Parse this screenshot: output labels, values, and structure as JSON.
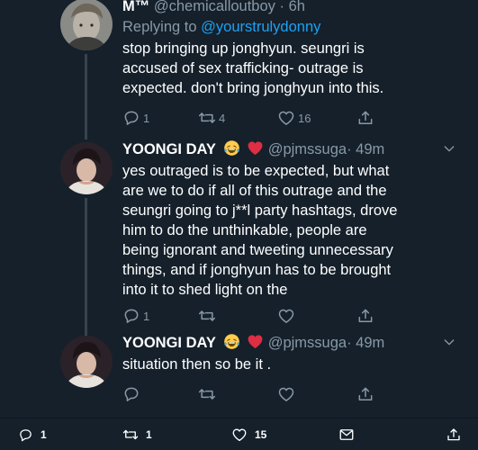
{
  "tweets": [
    {
      "display_name": "M™",
      "handle": "@chemicalloutboy",
      "time": "· 6h",
      "replying_prefix": "Replying to ",
      "replying_to": "@yourstrulydonny",
      "body_lines": [
        "stop bringing up jonghyun. seungri is",
        "accused of sex trafficking- outrage is",
        "expected. don't bring jonghyun into this."
      ],
      "reply_count": "1",
      "retweet_count": "4",
      "like_count": "16"
    },
    {
      "display_name": "YOONGI DAY",
      "name_emojis": [
        "laughing-crying-emoji",
        "red-heart-emoji"
      ],
      "handle": "@pjmssuga",
      "time": "· 49m",
      "body_lines": [
        "yes outraged is to be expected, but what",
        "are we to do if all of this outrage and the",
        "seungri going to j**l party hashtags, drove",
        "him to do the unthinkable, people are",
        "being ignorant and tweeting unnecessary",
        "things, and if jonghyun has to be brought",
        "into it to shed light on the"
      ],
      "reply_count": "1"
    },
    {
      "display_name": "YOONGI DAY",
      "name_emojis": [
        "laughing-crying-emoji",
        "red-heart-emoji"
      ],
      "handle": "@pjmssuga",
      "time": "· 49m",
      "body_lines": [
        "situation then so be it ."
      ]
    }
  ],
  "bottom_bar": {
    "reply_count": "1",
    "retweet_count": "1",
    "like_count": "15"
  },
  "colors": {
    "background": "#15202b",
    "secondary_text": "#8899a6",
    "link": "#1da1f2",
    "heart": "#e0245e",
    "thread_line": "#38444d"
  }
}
